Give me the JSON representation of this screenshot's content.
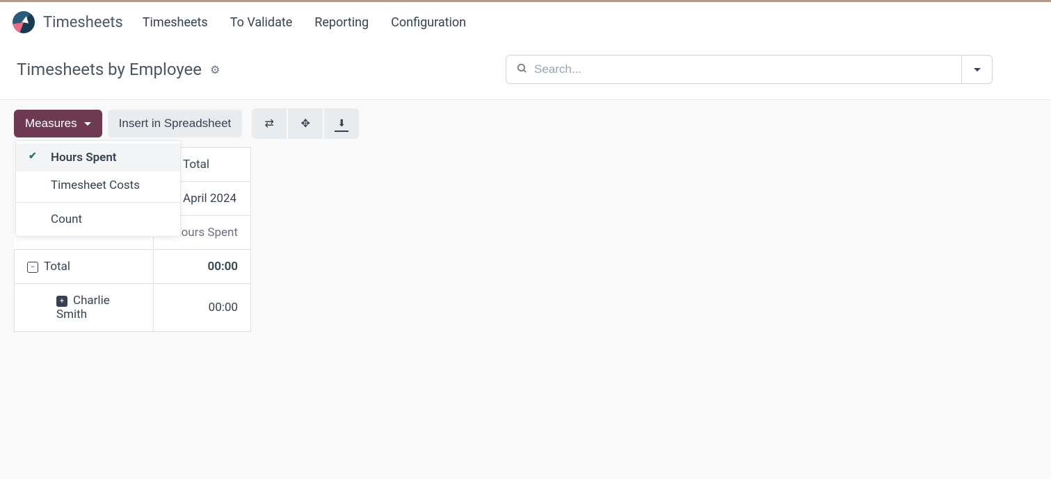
{
  "app": {
    "name": "Timesheets"
  },
  "nav": {
    "items": [
      "Timesheets",
      "To Validate",
      "Reporting",
      "Configuration"
    ]
  },
  "header": {
    "title": "Timesheets by Employee",
    "search_placeholder": "Search..."
  },
  "toolbar": {
    "measures_label": "Measures",
    "insert_label": "Insert in Spreadsheet"
  },
  "measures_dropdown": {
    "items": [
      {
        "label": "Hours Spent",
        "selected": true
      },
      {
        "label": "Timesheet Costs",
        "selected": false
      }
    ],
    "count_label": "Count"
  },
  "pivot": {
    "col_total": "Total",
    "col_period": "April 2024",
    "measure": "Hours Spent",
    "rows": [
      {
        "label": "Total",
        "value": "00:00",
        "bold": true,
        "expand": "minus"
      },
      {
        "label": "Charlie Smith",
        "value": "00:00",
        "bold": false,
        "expand": "plus",
        "indent": true
      }
    ]
  }
}
